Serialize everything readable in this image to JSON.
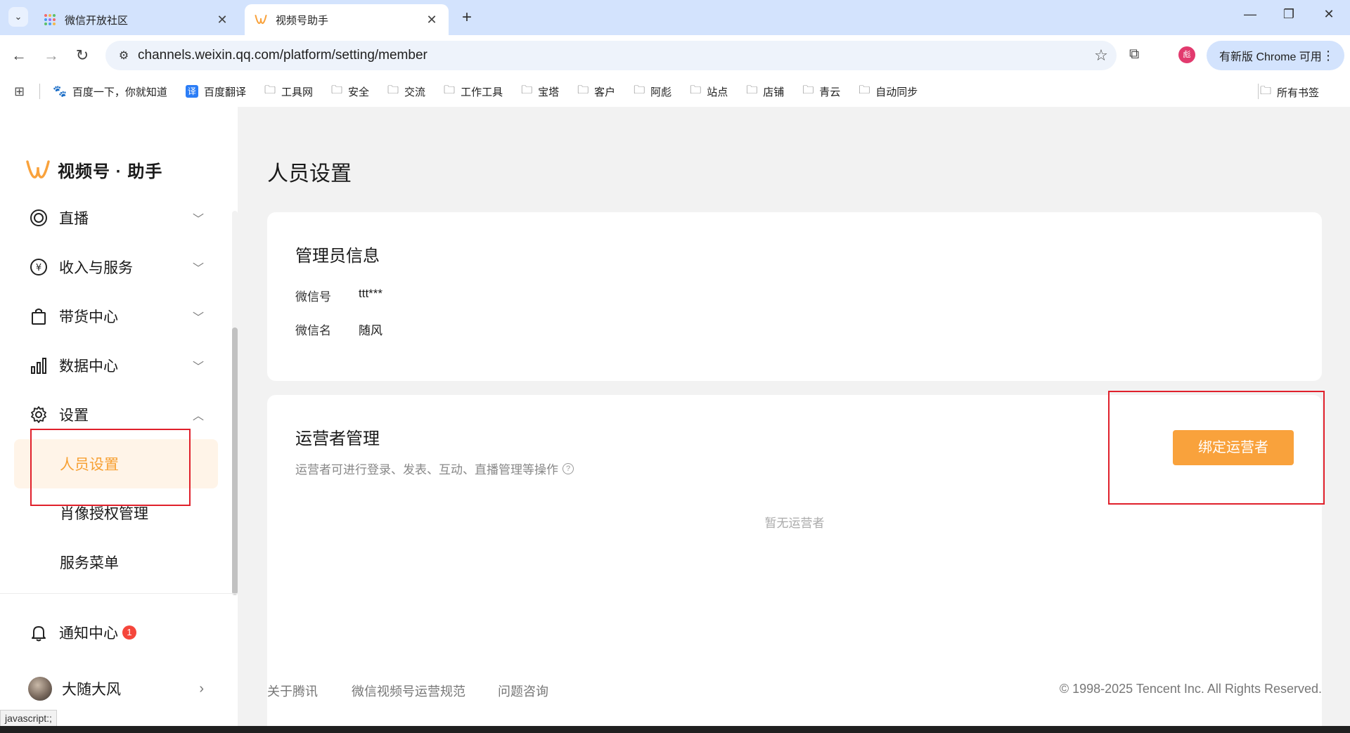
{
  "browser": {
    "tabs": [
      {
        "title": "微信开放社区",
        "active": false
      },
      {
        "title": "视频号助手",
        "active": true
      }
    ],
    "url": "channels.weixin.qq.com/platform/setting/member",
    "profile_initial": "彪",
    "update_label": "有新版 Chrome 可用",
    "bookmarks": [
      {
        "label": "百度一下，你就知道",
        "icon": "baidu-icon"
      },
      {
        "label": "百度翻译",
        "icon": "translate-icon"
      },
      {
        "label": "工具网",
        "icon": "folder-icon"
      },
      {
        "label": "安全",
        "icon": "folder-icon"
      },
      {
        "label": "交流",
        "icon": "folder-icon"
      },
      {
        "label": "工作工具",
        "icon": "folder-icon"
      },
      {
        "label": "宝塔",
        "icon": "folder-icon"
      },
      {
        "label": "客户",
        "icon": "folder-icon"
      },
      {
        "label": "阿彪",
        "icon": "folder-icon"
      },
      {
        "label": "站点",
        "icon": "folder-icon"
      },
      {
        "label": "店铺",
        "icon": "folder-icon"
      },
      {
        "label": "青云",
        "icon": "folder-icon"
      },
      {
        "label": "自动同步",
        "icon": "folder-icon"
      }
    ],
    "all_bookmarks": "所有书签",
    "status_tip": "javascript:;"
  },
  "sidebar": {
    "brand": "视频号 · 助手",
    "items": [
      {
        "label": "直播",
        "icon": "live-icon",
        "expanded": false
      },
      {
        "label": "收入与服务",
        "icon": "yuan-icon",
        "expanded": false
      },
      {
        "label": "带货中心",
        "icon": "shopping-bag-icon",
        "expanded": false
      },
      {
        "label": "数据中心",
        "icon": "bar-chart-icon",
        "expanded": false
      },
      {
        "label": "设置",
        "icon": "gear-icon",
        "expanded": true
      }
    ],
    "sub_items": [
      {
        "label": "人员设置",
        "active": true
      },
      {
        "label": "肖像授权管理",
        "active": false
      },
      {
        "label": "服务菜单",
        "active": false
      }
    ],
    "notice": {
      "label": "通知中心",
      "count": "1"
    },
    "user": {
      "name": "大随大风"
    }
  },
  "main": {
    "title": "人员设置",
    "admin": {
      "title": "管理员信息",
      "wechat_id_label": "微信号",
      "wechat_id": "ttt***",
      "wechat_name_label": "微信名",
      "wechat_name": "随风"
    },
    "operators": {
      "title": "运营者管理",
      "desc": "运营者可进行登录、发表、互动、直播管理等操作",
      "bind_button": "绑定运营者",
      "empty": "暂无运营者"
    }
  },
  "footer": {
    "links": [
      "关于腾讯",
      "微信视频号运营规范",
      "问题咨询"
    ],
    "copyright": "© 1998-2025 Tencent Inc. All Rights Reserved."
  },
  "colors": {
    "accent": "#f9a23c",
    "active_bg": "#fff4e8",
    "highlight_box": "#e0202b",
    "badge": "#f5463b"
  }
}
